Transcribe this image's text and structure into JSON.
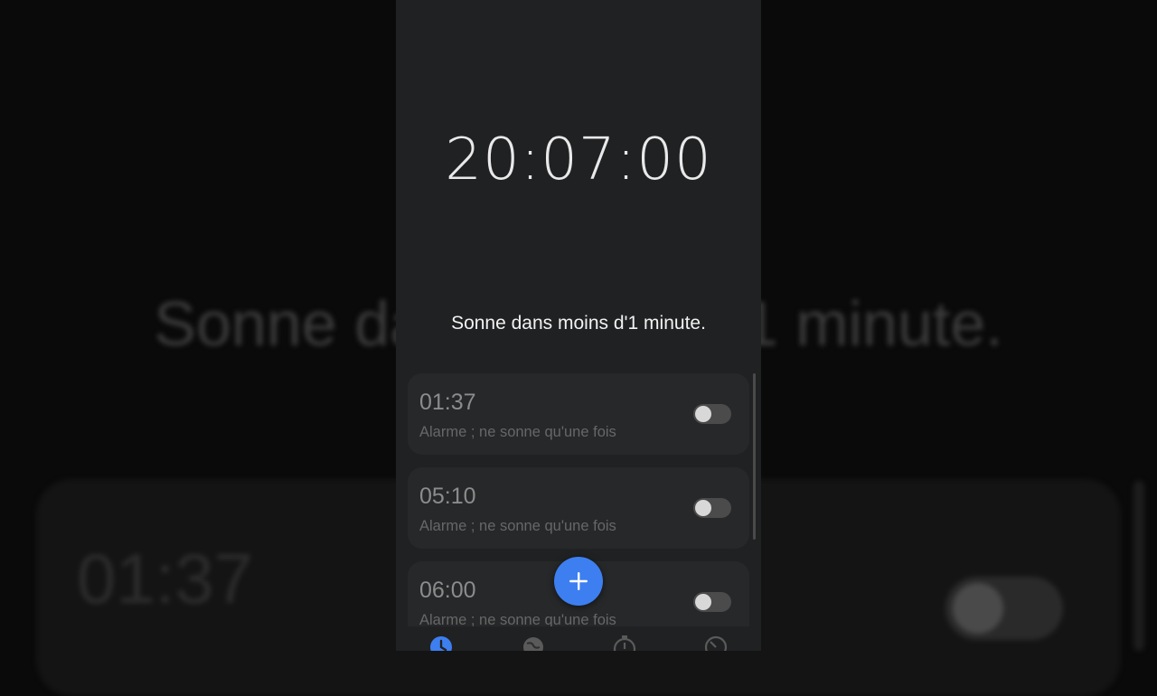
{
  "background": {
    "big_text": "Sonne dans moins d'1 minute.",
    "card_time": "01:37"
  },
  "clock": {
    "time": "20:07:00"
  },
  "next_ring": {
    "text": "Sonne dans moins d'1 minute."
  },
  "alarms": [
    {
      "time": "01:37",
      "description": "Alarme ; ne sonne qu'une fois",
      "enabled": false
    },
    {
      "time": "05:10",
      "description": "Alarme ; ne sonne qu'une fois",
      "enabled": false
    },
    {
      "time": "06:00",
      "description": "Alarme ; ne sonne qu'une fois",
      "enabled": false
    }
  ],
  "fab": {
    "icon": "plus-icon"
  },
  "bottom_nav": [
    {
      "icon": "alarm-clock-icon",
      "active": true
    },
    {
      "icon": "globe-icon",
      "active": false
    },
    {
      "icon": "stopwatch-icon",
      "active": false
    },
    {
      "icon": "timer-icon",
      "active": false
    }
  ],
  "colors": {
    "accent": "#3d7ff0",
    "phone_bg": "#202122",
    "card_bg": "#26282a",
    "toggle_off": "#4b4b4b"
  }
}
